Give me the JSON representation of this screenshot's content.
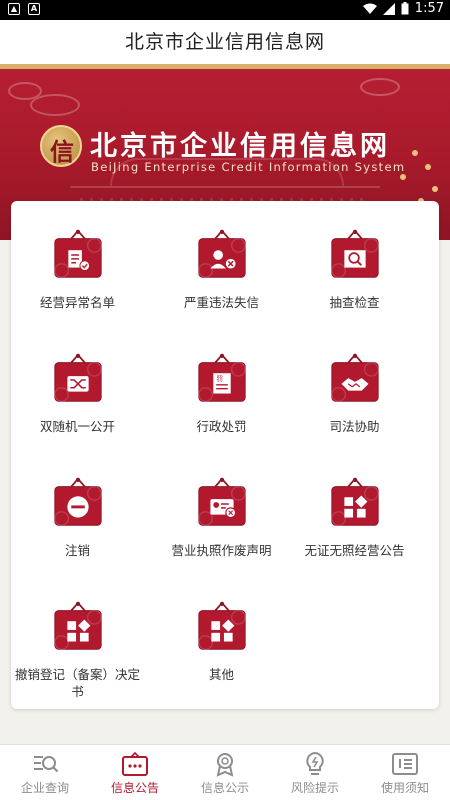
{
  "status_bar": {
    "time": "1:57"
  },
  "header": {
    "title": "北京市企业信用信息网"
  },
  "banner": {
    "seal_char": "信",
    "title": "北京市企业信用信息网",
    "subtitle": "BeiJing Enterprise Credit Information System"
  },
  "grid": [
    {
      "label": "经营异常名单",
      "icon": "abnormal-list-icon"
    },
    {
      "label": "严重违法失信",
      "icon": "serious-violation-icon"
    },
    {
      "label": "抽查检查",
      "icon": "inspection-icon"
    },
    {
      "label": "双随机一公开",
      "icon": "random-public-icon"
    },
    {
      "label": "行政处罚",
      "icon": "admin-penalty-icon"
    },
    {
      "label": "司法协助",
      "icon": "judicial-assist-icon"
    },
    {
      "label": "注销",
      "icon": "cancel-icon"
    },
    {
      "label": "营业执照作废声明",
      "icon": "license-void-icon"
    },
    {
      "label": "无证无照经营公告",
      "icon": "unlicensed-notice-icon"
    },
    {
      "label": "撤销登记（备案）决定书",
      "icon": "revoke-registration-icon"
    },
    {
      "label": "其他",
      "icon": "other-icon"
    }
  ],
  "tabs": [
    {
      "label": "企业查询",
      "icon": "search-list-icon",
      "active": false
    },
    {
      "label": "信息公告",
      "icon": "notice-board-icon",
      "active": true
    },
    {
      "label": "信息公示",
      "icon": "award-icon",
      "active": false
    },
    {
      "label": "风险提示",
      "icon": "lightbulb-warning-icon",
      "active": false
    },
    {
      "label": "使用须知",
      "icon": "document-icon",
      "active": false
    }
  ],
  "colors": {
    "brand_red": "#b2192e",
    "gold": "#d9b069",
    "inactive_gray": "#8d8d8d"
  }
}
